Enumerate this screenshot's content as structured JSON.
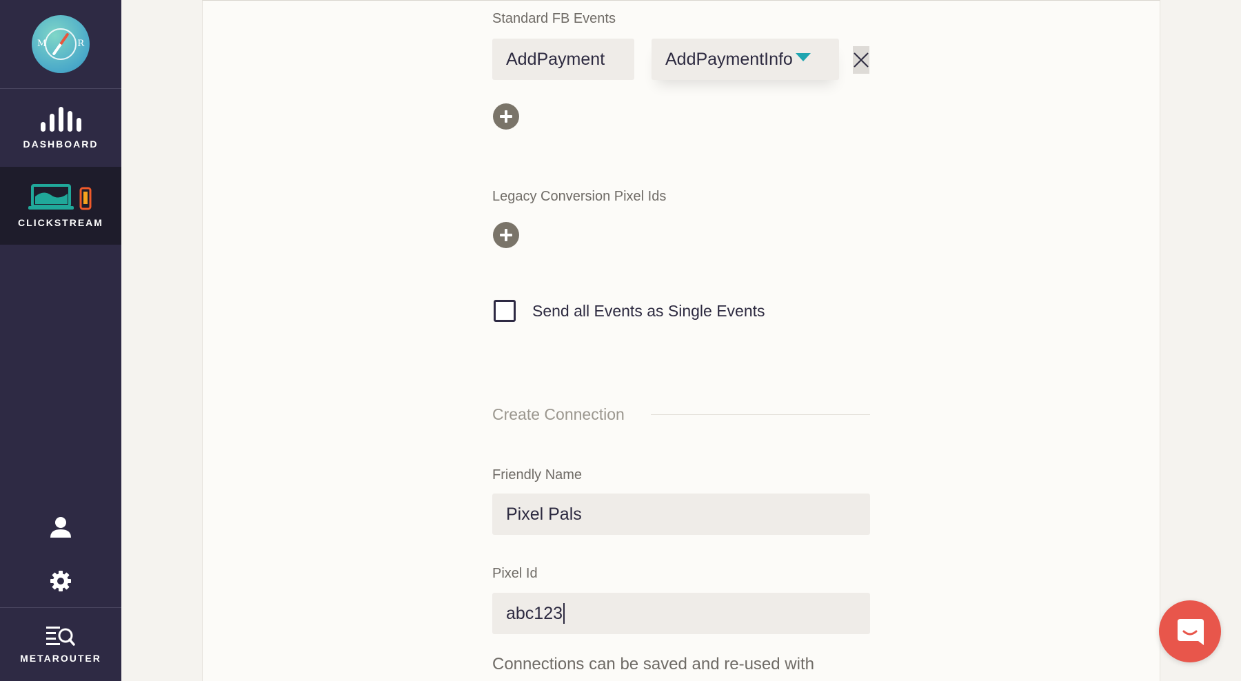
{
  "sidebar": {
    "logo_letters": {
      "left": "M",
      "right": "R"
    },
    "items": [
      {
        "label": "DASHBOARD",
        "icon": "bar-chart-icon"
      },
      {
        "label": "CLICKSTREAM",
        "icon": "clickstream-devices-icon",
        "active": true
      }
    ],
    "user_icon": "user-icon",
    "settings_icon": "gear-icon",
    "bottom_item": {
      "label": "METAROUTER",
      "icon": "search-list-icon"
    }
  },
  "form": {
    "standard_events": {
      "label": "Standard FB Events",
      "event_name_value": "AddPayment",
      "event_type_value": "AddPaymentInfo"
    },
    "legacy": {
      "label": "Legacy Conversion Pixel Ids"
    },
    "single_events": {
      "label": "Send all Events as Single Events",
      "checked": false
    },
    "create_connection": {
      "title": "Create Connection",
      "friendly_name_label": "Friendly Name",
      "friendly_name_value": "Pixel Pals",
      "pixel_id_label": "Pixel Id",
      "pixel_id_value": "abc123",
      "helper_text": "Connections can be saved and re-used with"
    }
  },
  "colors": {
    "sidebar_bg": "#2e2a44",
    "active_bg": "#1e1c2b",
    "accent_teal": "#1fa5b0",
    "chat_button": "#e8564b"
  }
}
